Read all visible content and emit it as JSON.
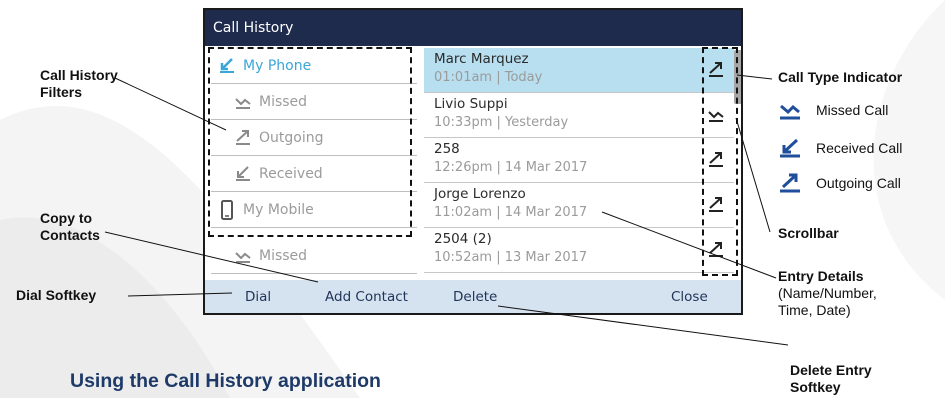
{
  "screen": {
    "title": "Call History",
    "filters": [
      {
        "label": "My Phone",
        "icon": "received-call-icon",
        "active": true
      },
      {
        "label": "Missed",
        "icon": "missed-call-icon",
        "active": false
      },
      {
        "label": "Outgoing",
        "icon": "outgoing-call-icon",
        "active": false
      },
      {
        "label": "Received",
        "icon": "received-call-icon",
        "active": false
      },
      {
        "label": "My Mobile",
        "icon": "mobile-phone-icon",
        "active": false
      },
      {
        "label": "Missed",
        "icon": "missed-call-icon",
        "active": false
      }
    ],
    "entries": [
      {
        "name": "Marc Marquez",
        "details": "01:01am | Today",
        "type": "outgoing",
        "selected": true
      },
      {
        "name": "Livio Suppi",
        "details": "10:33pm | Yesterday",
        "type": "missed",
        "selected": false
      },
      {
        "name": "258",
        "details": "12:26pm | 14 Mar 2017",
        "type": "outgoing",
        "selected": false
      },
      {
        "name": "Jorge Lorenzo",
        "details": "11:02am | 14 Mar 2017",
        "type": "outgoing",
        "selected": false
      },
      {
        "name": "2504 (2)",
        "details": "10:52am | 13 Mar 2017",
        "type": "outgoing",
        "selected": false
      }
    ],
    "softkeys": {
      "dial": "Dial",
      "add_contact": "Add Contact",
      "delete": "Delete",
      "close": "Close"
    }
  },
  "callouts": {
    "filters": "Call History\nFilters",
    "copy": "Copy to\nContacts",
    "dial": "Dial Softkey",
    "type_indicator": "Call Type Indicator",
    "scrollbar": "Scrollbar",
    "entry_details_title": "Entry Details",
    "entry_details_sub": "(Name/Number,\nTime, Date)",
    "delete_softkey": "Delete Entry\nSoftkey"
  },
  "legend": [
    {
      "label": "Missed Call",
      "icon": "missed-call-icon"
    },
    {
      "label": "Received Call",
      "icon": "received-call-icon"
    },
    {
      "label": "Outgoing Call",
      "icon": "outgoing-call-icon"
    }
  ],
  "heading": "Using the Call History application",
  "colors": {
    "titlebar": "#1e2b4d",
    "selected_row": "#b7dff0",
    "softkey_bar": "#d5e2ef",
    "active_filter": "#3aa6d8",
    "legend_icon": "#1f4e9a",
    "heading": "#1e3a68"
  }
}
